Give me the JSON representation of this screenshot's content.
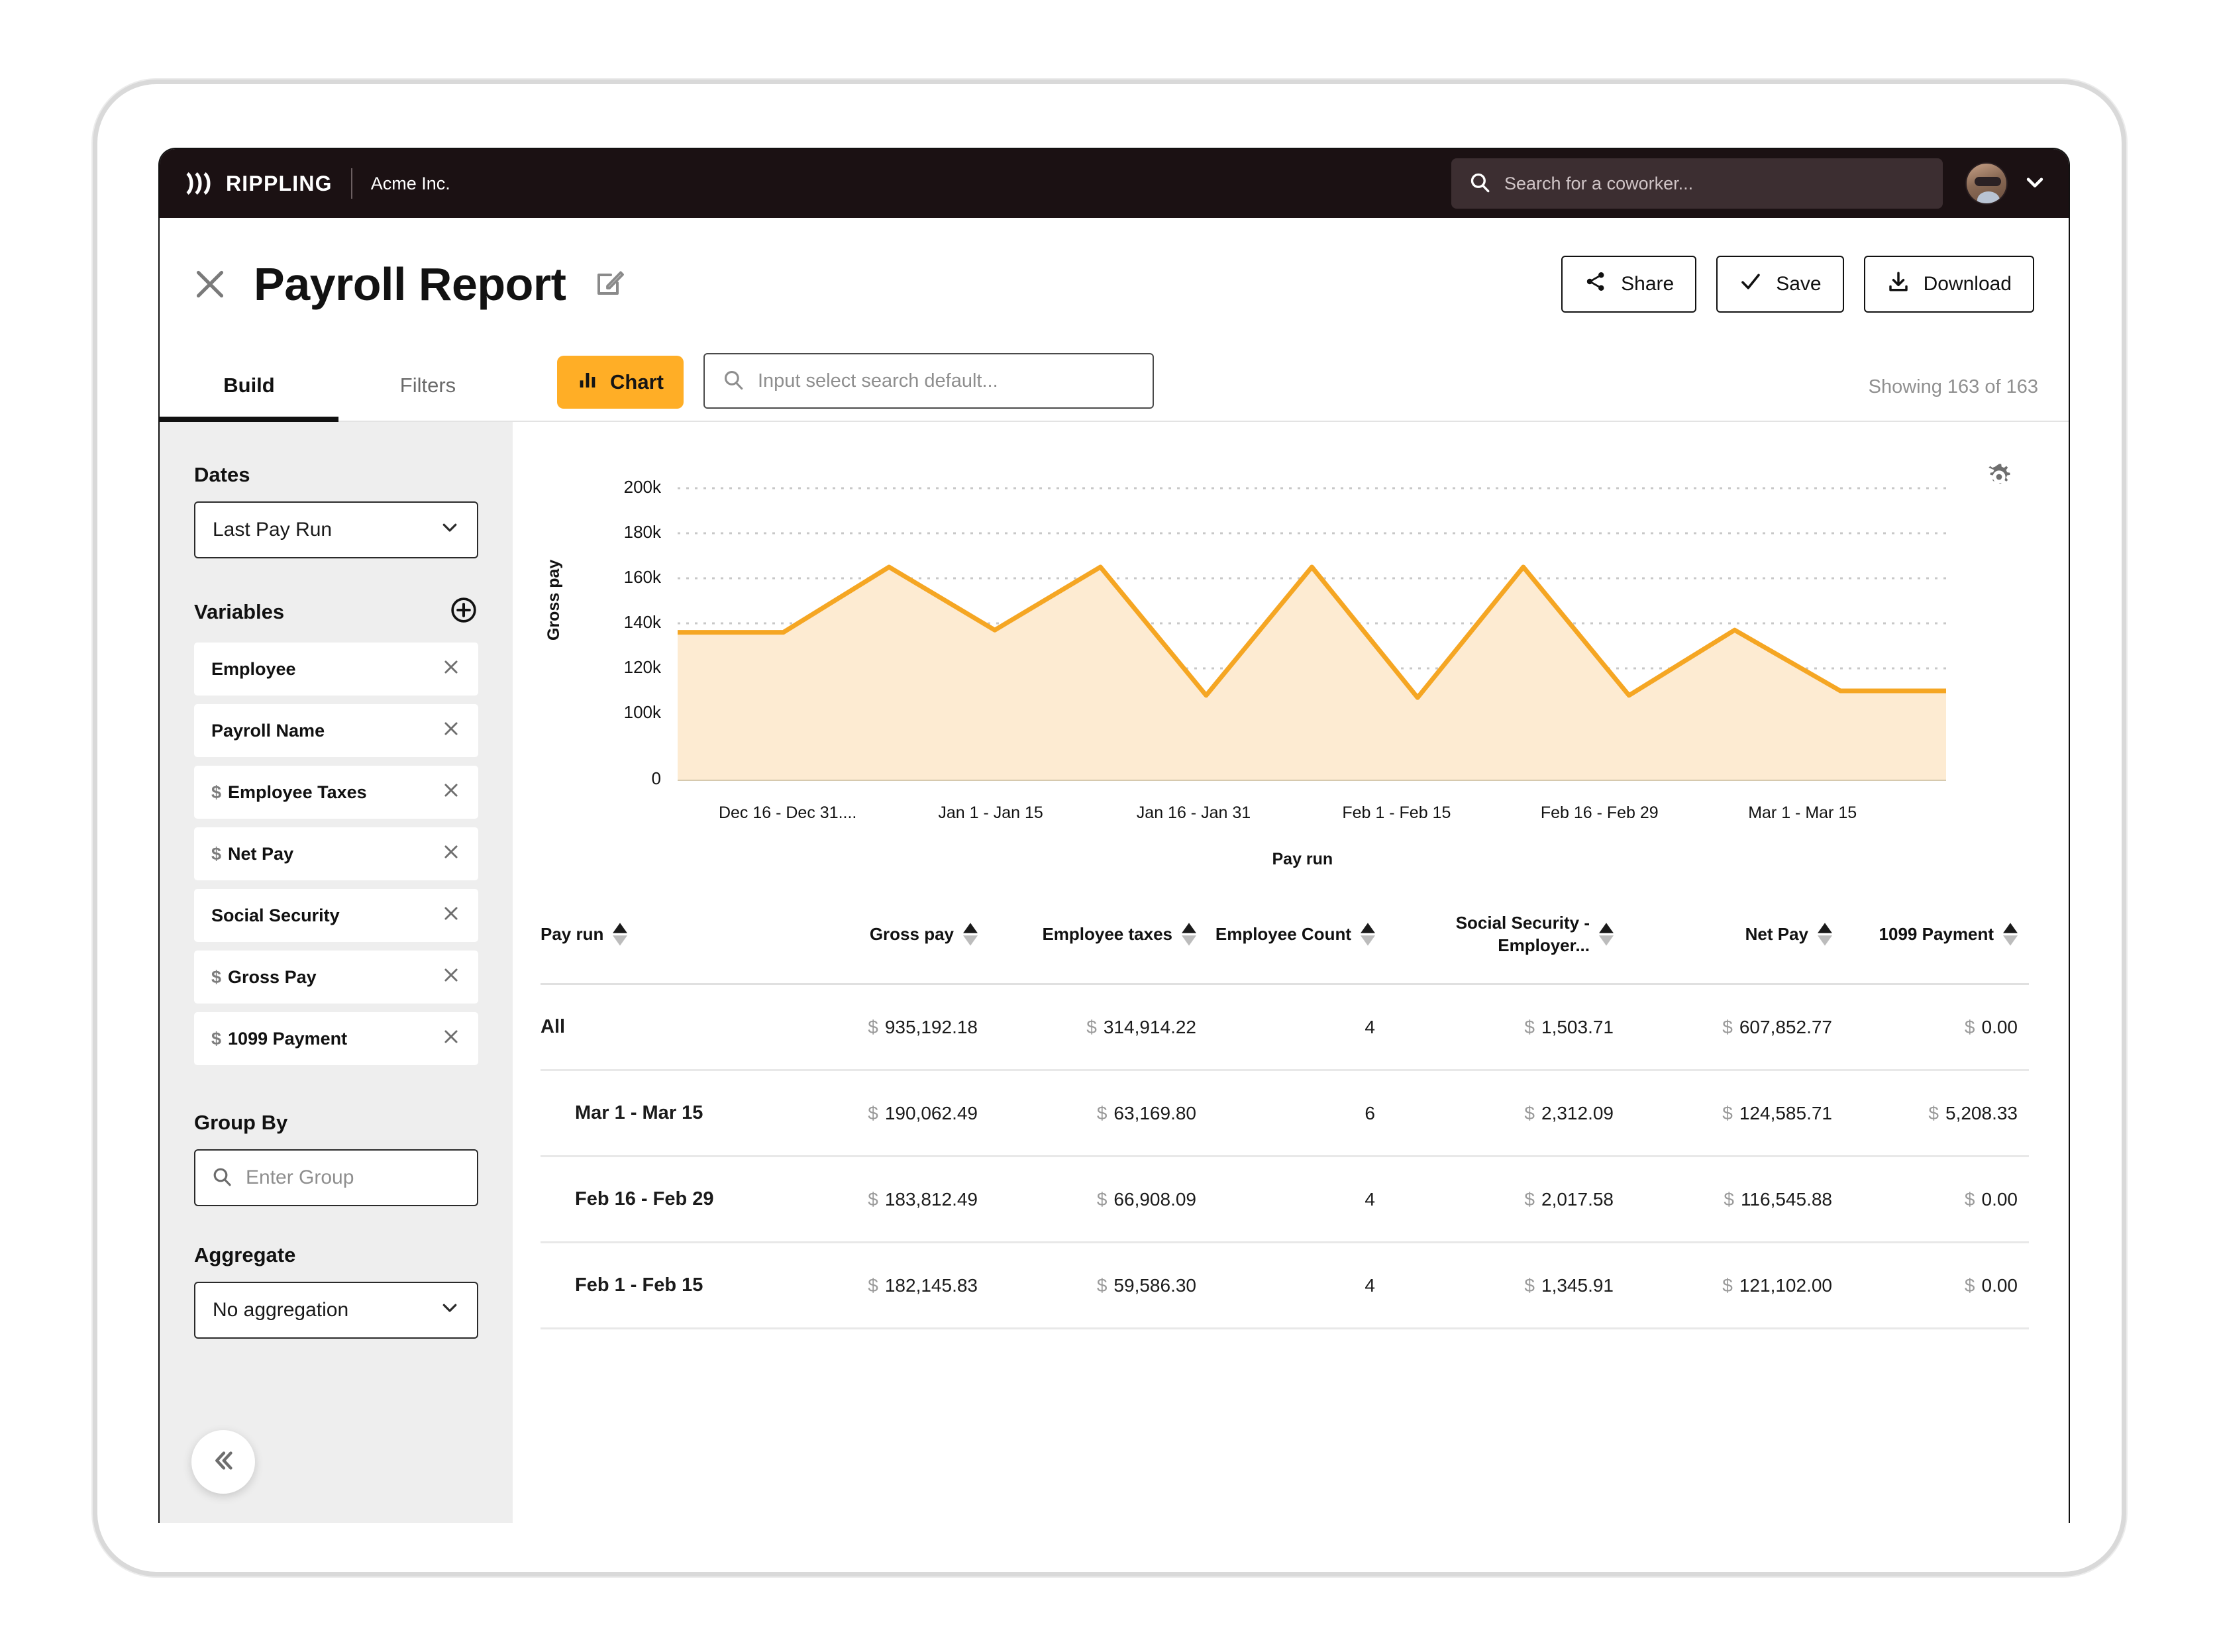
{
  "topbar": {
    "brand": "RIPPLING",
    "org": "Acme Inc.",
    "search_placeholder": "Search for a coworker...",
    "search_icon": "search-icon",
    "caret_icon": "chevron-down-icon"
  },
  "header": {
    "close_icon": "close-icon",
    "title": "Payroll Report",
    "edit_icon": "edit-pencil-icon",
    "buttons": [
      {
        "label": "Share",
        "icon": "share-icon"
      },
      {
        "label": "Save",
        "icon": "check-icon"
      },
      {
        "label": "Download",
        "icon": "download-icon"
      }
    ]
  },
  "tabs": [
    {
      "label": "Build",
      "active": true
    },
    {
      "label": "Filters",
      "active": false
    }
  ],
  "toolbar": {
    "chart_label": "Chart",
    "chart_icon": "bar-chart-icon",
    "select_search_placeholder": "Input select search default...",
    "select_search_icon": "search-icon",
    "showing": "Showing 163 of 163",
    "gear_icon": "gear-icon"
  },
  "sidebar": {
    "dates_label": "Dates",
    "dates_value": "Last Pay Run",
    "variables_label": "Variables",
    "add_icon": "plus-circle-icon",
    "variables": [
      {
        "label": "Employee",
        "currency": false
      },
      {
        "label": "Payroll Name",
        "currency": false
      },
      {
        "label": "Employee Taxes",
        "currency": true
      },
      {
        "label": "Net Pay",
        "currency": true
      },
      {
        "label": "Social Security",
        "currency": false
      },
      {
        "label": "Gross Pay",
        "currency": true
      },
      {
        "label": "1099 Payment",
        "currency": true
      }
    ],
    "remove_icon": "close-icon",
    "group_by_label": "Group By",
    "group_by_placeholder": "Enter Group",
    "group_by_icon": "search-icon",
    "aggregate_label": "Aggregate",
    "aggregate_value": "No aggregation",
    "collapse_icon": "chevron-double-left-icon"
  },
  "chart_data": {
    "type": "area",
    "title": "",
    "xlabel": "Pay run",
    "ylabel": "Gross pay",
    "x": [
      "Dec 16 - Dec 31....",
      "Jan 1 - Jan 15",
      "Jan 16 - Jan 31",
      "Feb 1 - Feb 15",
      "Feb 16 - Feb 29",
      "Mar 1 - Mar 15"
    ],
    "categories": [
      "Dec 16 - Dec 31....",
      "Jan 1 - Jan 15",
      "Jan 16 - Jan 31",
      "Feb 1 - Feb 15",
      "Feb 16 - Feb 29",
      "Mar 1 - Mar 15"
    ],
    "values": [
      136000,
      136000,
      165000,
      137000,
      165000,
      108000,
      165000,
      107000,
      165000,
      108000,
      137000,
      110000,
      110000
    ],
    "ytick_labels": [
      "0",
      "100k",
      "120k",
      "140k",
      "160k",
      "180k",
      "200k"
    ],
    "ytick_values": [
      0,
      100000,
      120000,
      140000,
      160000,
      180000,
      200000
    ],
    "ylim": [
      0,
      200000
    ],
    "grid": true,
    "legend": "none",
    "line_color": "#F5A623",
    "fill_color": "#FDEBD2"
  },
  "table": {
    "columns": [
      {
        "key": "pay_run",
        "label": "Pay run"
      },
      {
        "key": "gross_pay",
        "label": "Gross pay"
      },
      {
        "key": "employee_taxes",
        "label": "Employee taxes"
      },
      {
        "key": "employee_count",
        "label": "Employee Count"
      },
      {
        "key": "social_security_employer",
        "label": "Social Security - Employer..."
      },
      {
        "key": "net_pay",
        "label": "Net Pay"
      },
      {
        "key": "payment_1099",
        "label": "1099 Payment"
      }
    ],
    "currency_symbol": "$",
    "rows": [
      {
        "pay_run": "All",
        "indent": false,
        "gross_pay": "935,192.18",
        "employee_taxes": "314,914.22",
        "employee_count": "4",
        "social_security_employer": "1,503.71",
        "net_pay": "607,852.77",
        "payment_1099": "0.00"
      },
      {
        "pay_run": "Mar 1 - Mar 15",
        "indent": true,
        "gross_pay": "190,062.49",
        "employee_taxes": "63,169.80",
        "employee_count": "6",
        "social_security_employer": "2,312.09",
        "net_pay": "124,585.71",
        "payment_1099": "5,208.33"
      },
      {
        "pay_run": "Feb 16 - Feb 29",
        "indent": true,
        "gross_pay": "183,812.49",
        "employee_taxes": "66,908.09",
        "employee_count": "4",
        "social_security_employer": "2,017.58",
        "net_pay": "116,545.88",
        "payment_1099": "0.00"
      },
      {
        "pay_run": "Feb 1 - Feb 15",
        "indent": true,
        "gross_pay": "182,145.83",
        "employee_taxes": "59,586.30",
        "employee_count": "4",
        "social_security_employer": "1,345.91",
        "net_pay": "121,102.00",
        "payment_1099": "0.00"
      }
    ],
    "sort_icon": "sort-arrows-icon"
  },
  "colors": {
    "accent": "#FFAE26",
    "chart_line": "#F5A623",
    "chart_fill": "#FDEBD2",
    "nav_bg": "#1B1113",
    "sidebar_bg": "#EEEEEE"
  }
}
